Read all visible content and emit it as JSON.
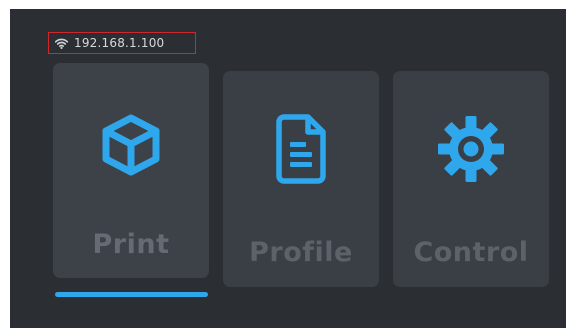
{
  "status": {
    "ip_address": "192.168.1.100",
    "wifi_icon": "wifi-icon"
  },
  "tabs": [
    {
      "label": "Print",
      "icon": "cube-icon",
      "active": true
    },
    {
      "label": "Profile",
      "icon": "document-icon",
      "active": false
    },
    {
      "label": "Control",
      "icon": "gear-icon",
      "active": false
    }
  ],
  "colors": {
    "background": "#2b2e33",
    "tile": "#3a3e45",
    "accent": "#2fa7ec",
    "label": "#5d6168",
    "ip_highlight_border": "#d0262e"
  }
}
